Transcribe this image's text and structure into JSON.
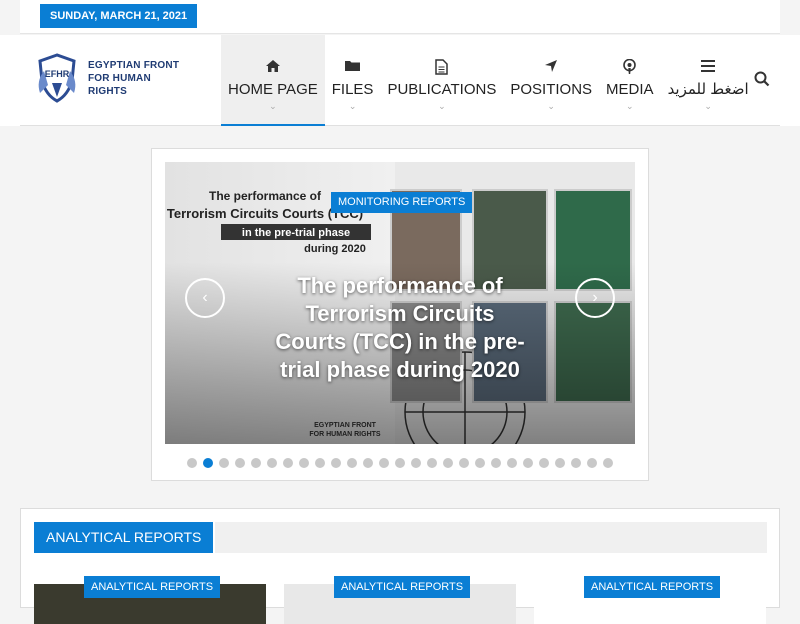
{
  "topbar": {
    "date": "SUNDAY, MARCH 21, 2021"
  },
  "logo": {
    "abbr": "EFHR",
    "line1": "EGYPTIAN FRONT",
    "line2": "FOR HUMAN RIGHTS"
  },
  "nav": {
    "items": [
      {
        "label": "HOME PAGE",
        "icon": "home-icon"
      },
      {
        "label": "FILES",
        "icon": "folder-icon"
      },
      {
        "label": "PUBLICATIONS",
        "icon": "document-icon"
      },
      {
        "label": "POSITIONS",
        "icon": "location-arrow-icon"
      },
      {
        "label": "MEDIA",
        "icon": "podcast-icon"
      },
      {
        "label": "اضغط للمزيد",
        "icon": "menu-icon"
      }
    ]
  },
  "slider": {
    "tag": "MONITORING REPORTS",
    "title": "The performance of Terrorism Circuits Courts (TCC) in the pre-trial phase during 2020",
    "image_heading": "The performance of Terrorism Circuits Courts (TCC) in the pre-trial phase during 2020",
    "image_footer": "EGYPTIAN FRONT FOR HUMAN RIGHTS",
    "dot_count": 27,
    "active_dot": 1
  },
  "section": {
    "title": "ANALYTICAL REPORTS",
    "cards": [
      {
        "tag": "ANALYTICAL REPORTS"
      },
      {
        "tag": "ANALYTICAL REPORTS"
      },
      {
        "tag": "ANALYTICAL REPORTS"
      }
    ]
  },
  "colors": {
    "accent": "#0a7ed4"
  }
}
